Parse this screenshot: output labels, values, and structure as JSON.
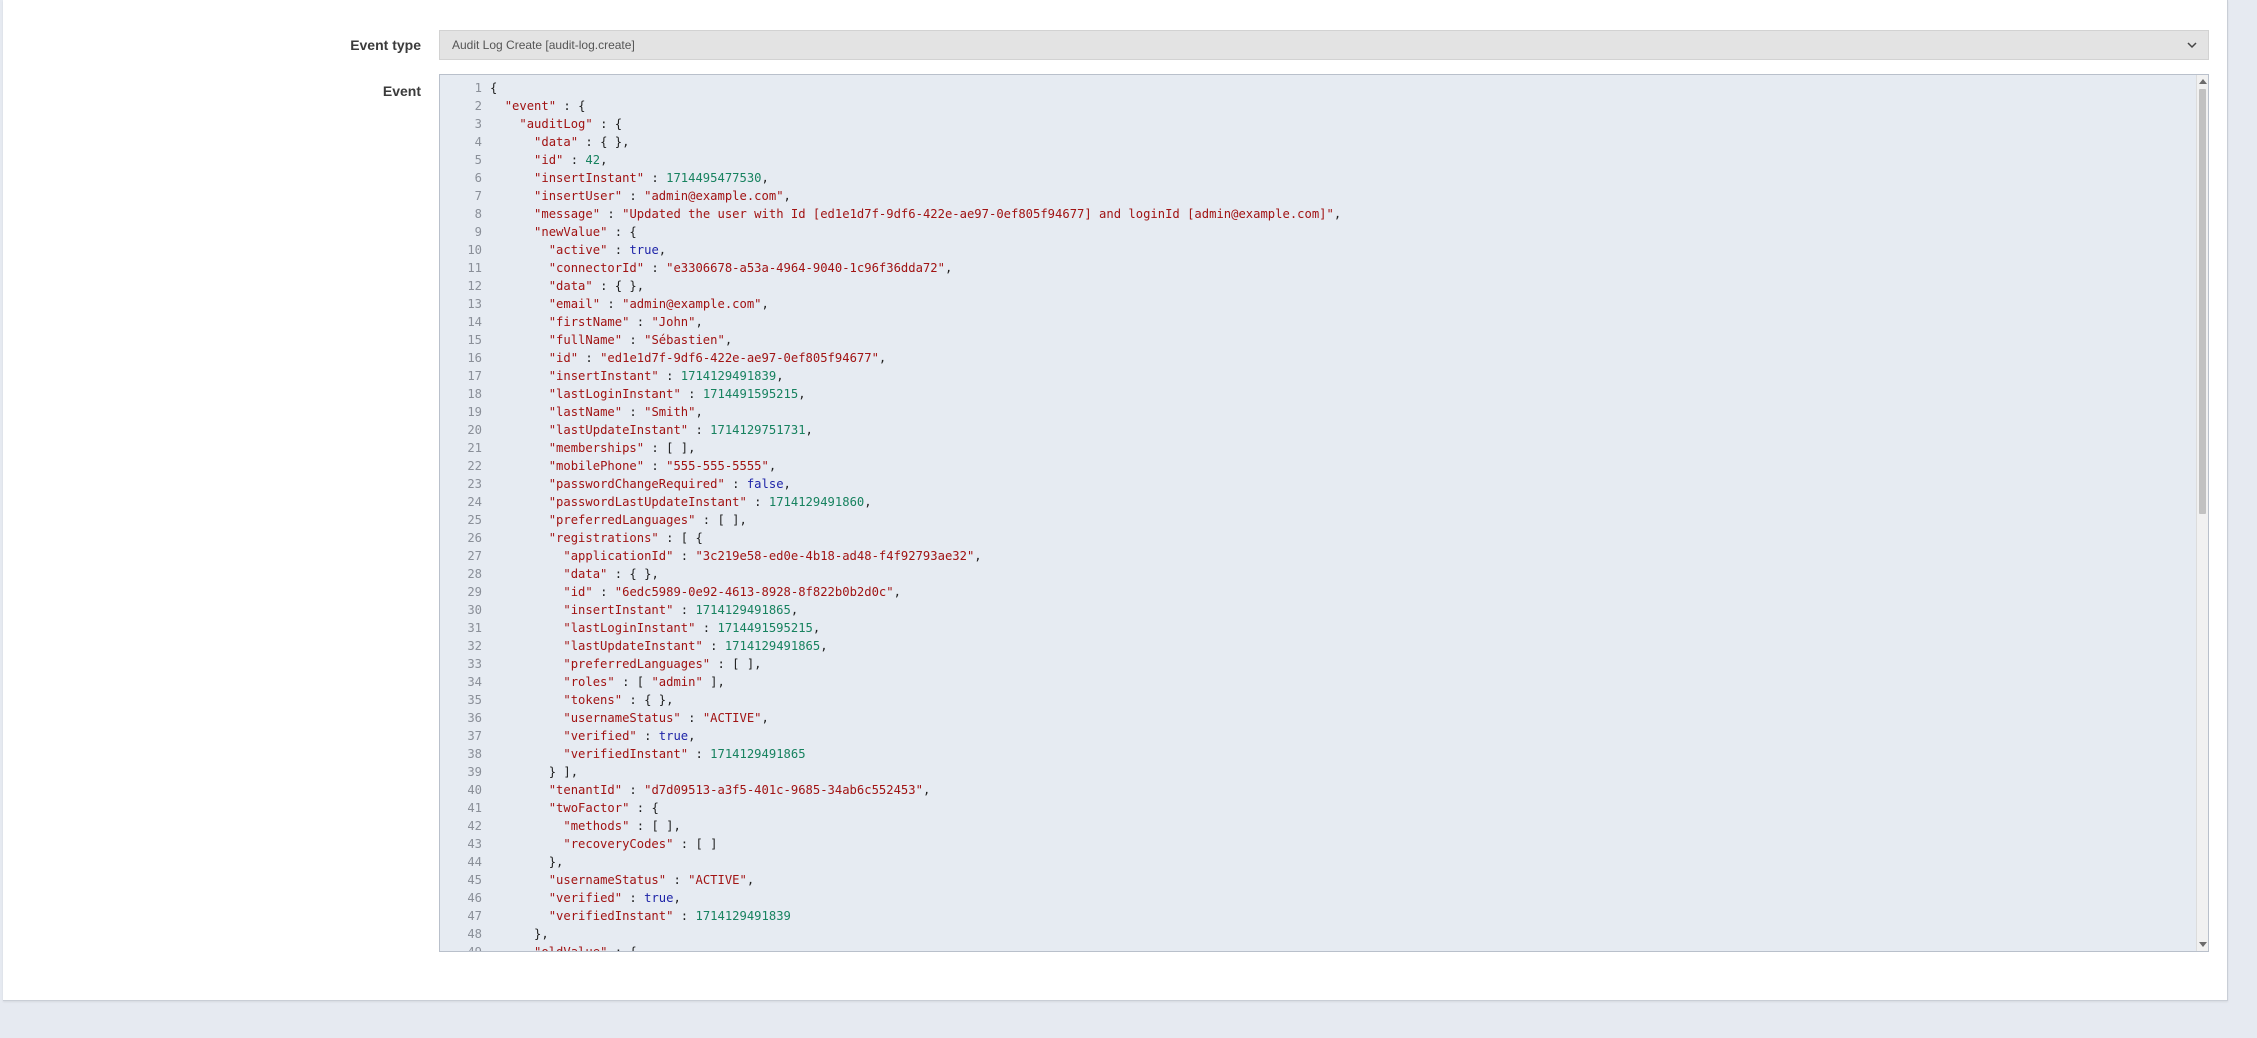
{
  "form": {
    "event_type_label": "Event type",
    "event_type_value": "Audit Log Create [audit-log.create]",
    "event_label": "Event"
  },
  "editor": {
    "lines": [
      "{",
      "  \"event\" : {",
      "    \"auditLog\" : {",
      "      \"data\" : { },",
      "      \"id\" : 42,",
      "      \"insertInstant\" : 1714495477530,",
      "      \"insertUser\" : \"admin@example.com\",",
      "      \"message\" : \"Updated the user with Id [ed1e1d7f-9df6-422e-ae97-0ef805f94677] and loginId [admin@example.com]\",",
      "      \"newValue\" : {",
      "        \"active\" : true,",
      "        \"connectorId\" : \"e3306678-a53a-4964-9040-1c96f36dda72\",",
      "        \"data\" : { },",
      "        \"email\" : \"admin@example.com\",",
      "        \"firstName\" : \"John\",",
      "        \"fullName\" : \"Sébastien\",",
      "        \"id\" : \"ed1e1d7f-9df6-422e-ae97-0ef805f94677\",",
      "        \"insertInstant\" : 1714129491839,",
      "        \"lastLoginInstant\" : 1714491595215,",
      "        \"lastName\" : \"Smith\",",
      "        \"lastUpdateInstant\" : 1714129751731,",
      "        \"memberships\" : [ ],",
      "        \"mobilePhone\" : \"555-555-5555\",",
      "        \"passwordChangeRequired\" : false,",
      "        \"passwordLastUpdateInstant\" : 1714129491860,",
      "        \"preferredLanguages\" : [ ],",
      "        \"registrations\" : [ {",
      "          \"applicationId\" : \"3c219e58-ed0e-4b18-ad48-f4f92793ae32\",",
      "          \"data\" : { },",
      "          \"id\" : \"6edc5989-0e92-4613-8928-8f822b0b2d0c\",",
      "          \"insertInstant\" : 1714129491865,",
      "          \"lastLoginInstant\" : 1714491595215,",
      "          \"lastUpdateInstant\" : 1714129491865,",
      "          \"preferredLanguages\" : [ ],",
      "          \"roles\" : [ \"admin\" ],",
      "          \"tokens\" : { },",
      "          \"usernameStatus\" : \"ACTIVE\",",
      "          \"verified\" : true,",
      "          \"verifiedInstant\" : 1714129491865",
      "        } ],",
      "        \"tenantId\" : \"d7d09513-a3f5-401c-9685-34ab6c552453\",",
      "        \"twoFactor\" : {",
      "          \"methods\" : [ ],",
      "          \"recoveryCodes\" : [ ]",
      "        },",
      "        \"usernameStatus\" : \"ACTIVE\",",
      "        \"verified\" : true,",
      "        \"verifiedInstant\" : 1714129491839",
      "      },",
      "      \"oldValue\" : {"
    ]
  },
  "colors": {
    "key": "#a11313",
    "string": "#a11313",
    "number": "#17825f",
    "boolean": "#1e24a8",
    "editor_bg": "#e6ebf2",
    "page_bg": "#e6eaf1"
  },
  "icons": {
    "select_chevron": "chevron-down-icon",
    "scroll_up": "scroll-up-arrow-icon",
    "scroll_down": "scroll-down-arrow-icon"
  }
}
